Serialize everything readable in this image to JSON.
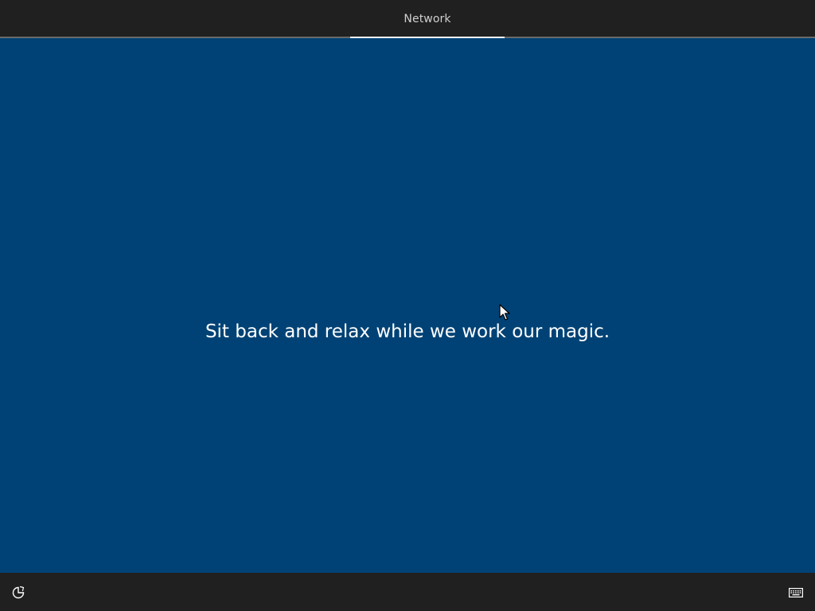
{
  "header": {
    "tabs": [
      {
        "label": "Network",
        "active": true
      }
    ]
  },
  "main": {
    "message": "Sit back and relax while we work our magic."
  },
  "footer": {
    "left_icon": "ease-of-access-icon",
    "right_icon": "keyboard-icon"
  },
  "colors": {
    "background": "#004275",
    "bars": "#202020",
    "text": "#ffffff",
    "tab_text": "#cfcfcf"
  }
}
